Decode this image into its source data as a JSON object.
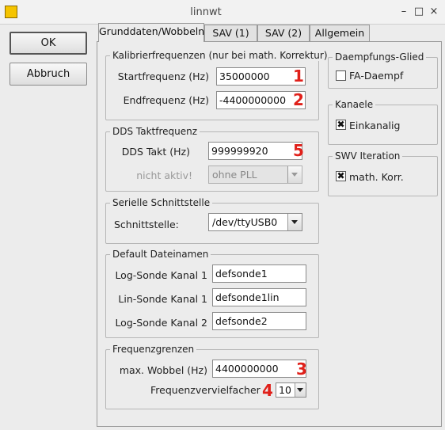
{
  "window": {
    "title": "linnwt",
    "minimize": "–",
    "maximize": "□",
    "close": "×"
  },
  "buttons": {
    "ok": "OK",
    "cancel": "Abbruch"
  },
  "tabs": [
    {
      "label": "Grunddaten/Wobbeln"
    },
    {
      "label": "SAV (1)"
    },
    {
      "label": "SAV (2)"
    },
    {
      "label": "Allgemein"
    }
  ],
  "calibration": {
    "title": "Kalibrierfrequenzen (nur bei math. Korrektur)",
    "start_label": "Startfrequenz (Hz)",
    "start_value": "35000000",
    "end_label": "Endfrequenz (Hz)",
    "end_value": "-4400000000"
  },
  "dds": {
    "title": "DDS Taktfrequenz",
    "clock_label": "DDS Takt (Hz)",
    "clock_value": "999999920",
    "pll_label": "nicht aktiv!",
    "pll_value": "ohne PLL"
  },
  "serial": {
    "title": "Serielle Schnittstelle",
    "port_label": "Schnittstelle:",
    "port_value": "/dev/ttyUSB0"
  },
  "filenames": {
    "title": "Default Dateinamen",
    "log1_label": "Log-Sonde Kanal 1",
    "log1_value": "defsonde1",
    "lin1_label": "Lin-Sonde Kanal 1",
    "lin1_value": "defsonde1lin",
    "log2_label": "Log-Sonde Kanal 2",
    "log2_value": "defsonde2"
  },
  "freqlimits": {
    "title": "Frequenzgrenzen",
    "max_label": "max. Wobbel (Hz)",
    "max_value": "4400000000",
    "mult_label": "Frequenzvervielfacher",
    "mult_value": "10"
  },
  "attenuator": {
    "title": "Daempfungs-Glied",
    "checkbox_label": "FA-Daempf",
    "checked": false
  },
  "channels": {
    "title": "Kanaele",
    "checkbox_label": "Einkanalig",
    "checked": true
  },
  "swv": {
    "title": "SWV Iteration",
    "checkbox_label": "math. Korr.",
    "checked": true
  },
  "annotations": {
    "n1": "1",
    "n2": "2",
    "n3": "3",
    "n4": "4",
    "n5": "5",
    "color": "#e0201a"
  },
  "icons": {
    "app": "linnwt-app-icon",
    "combo_arrow": "chevron-down-icon",
    "check": "✖"
  }
}
